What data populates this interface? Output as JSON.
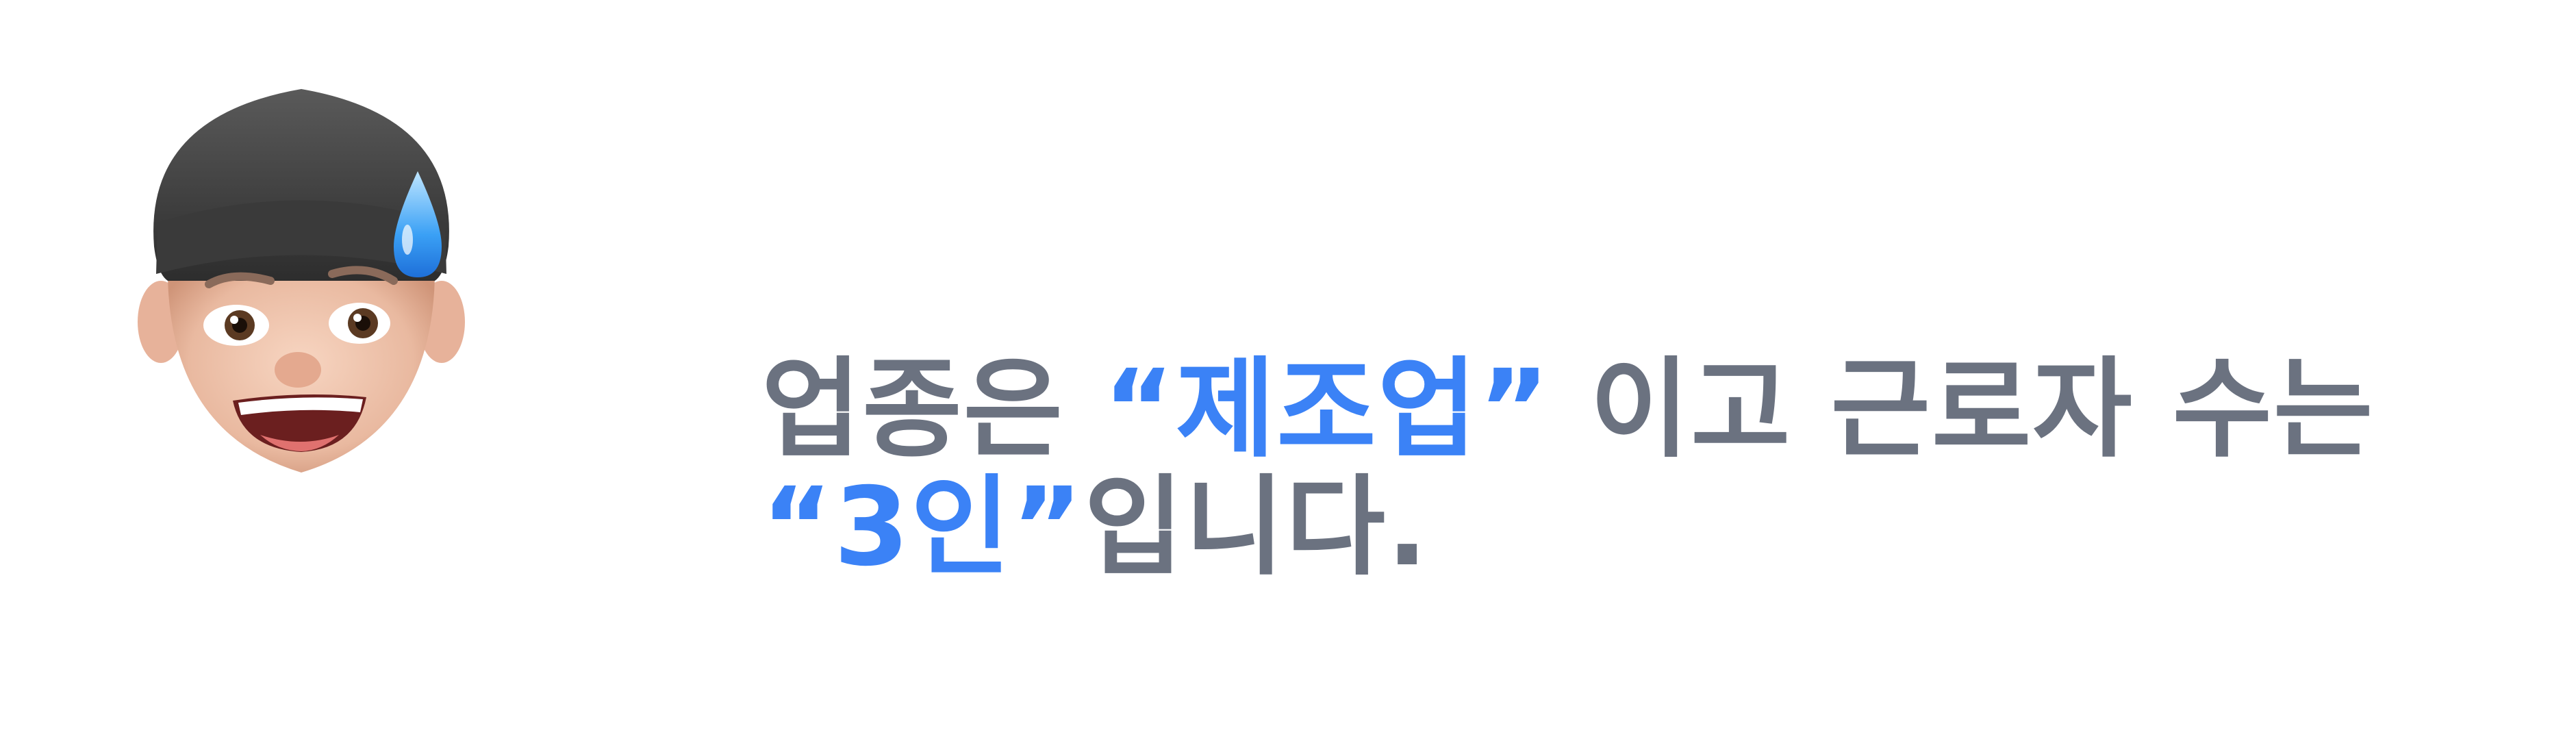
{
  "colors": {
    "text": "#6b7280",
    "highlight": "#3b82f6",
    "background": "#ffffff"
  },
  "avatar": {
    "icon": "memoji-sweat-drop-icon"
  },
  "message": {
    "line1": {
      "part1": "업종은 ",
      "highlight1": "“제조업”",
      "part2": " 이고 근로자 수는"
    },
    "line2": {
      "highlight2": "“3인”",
      "part3": "입니다."
    }
  }
}
